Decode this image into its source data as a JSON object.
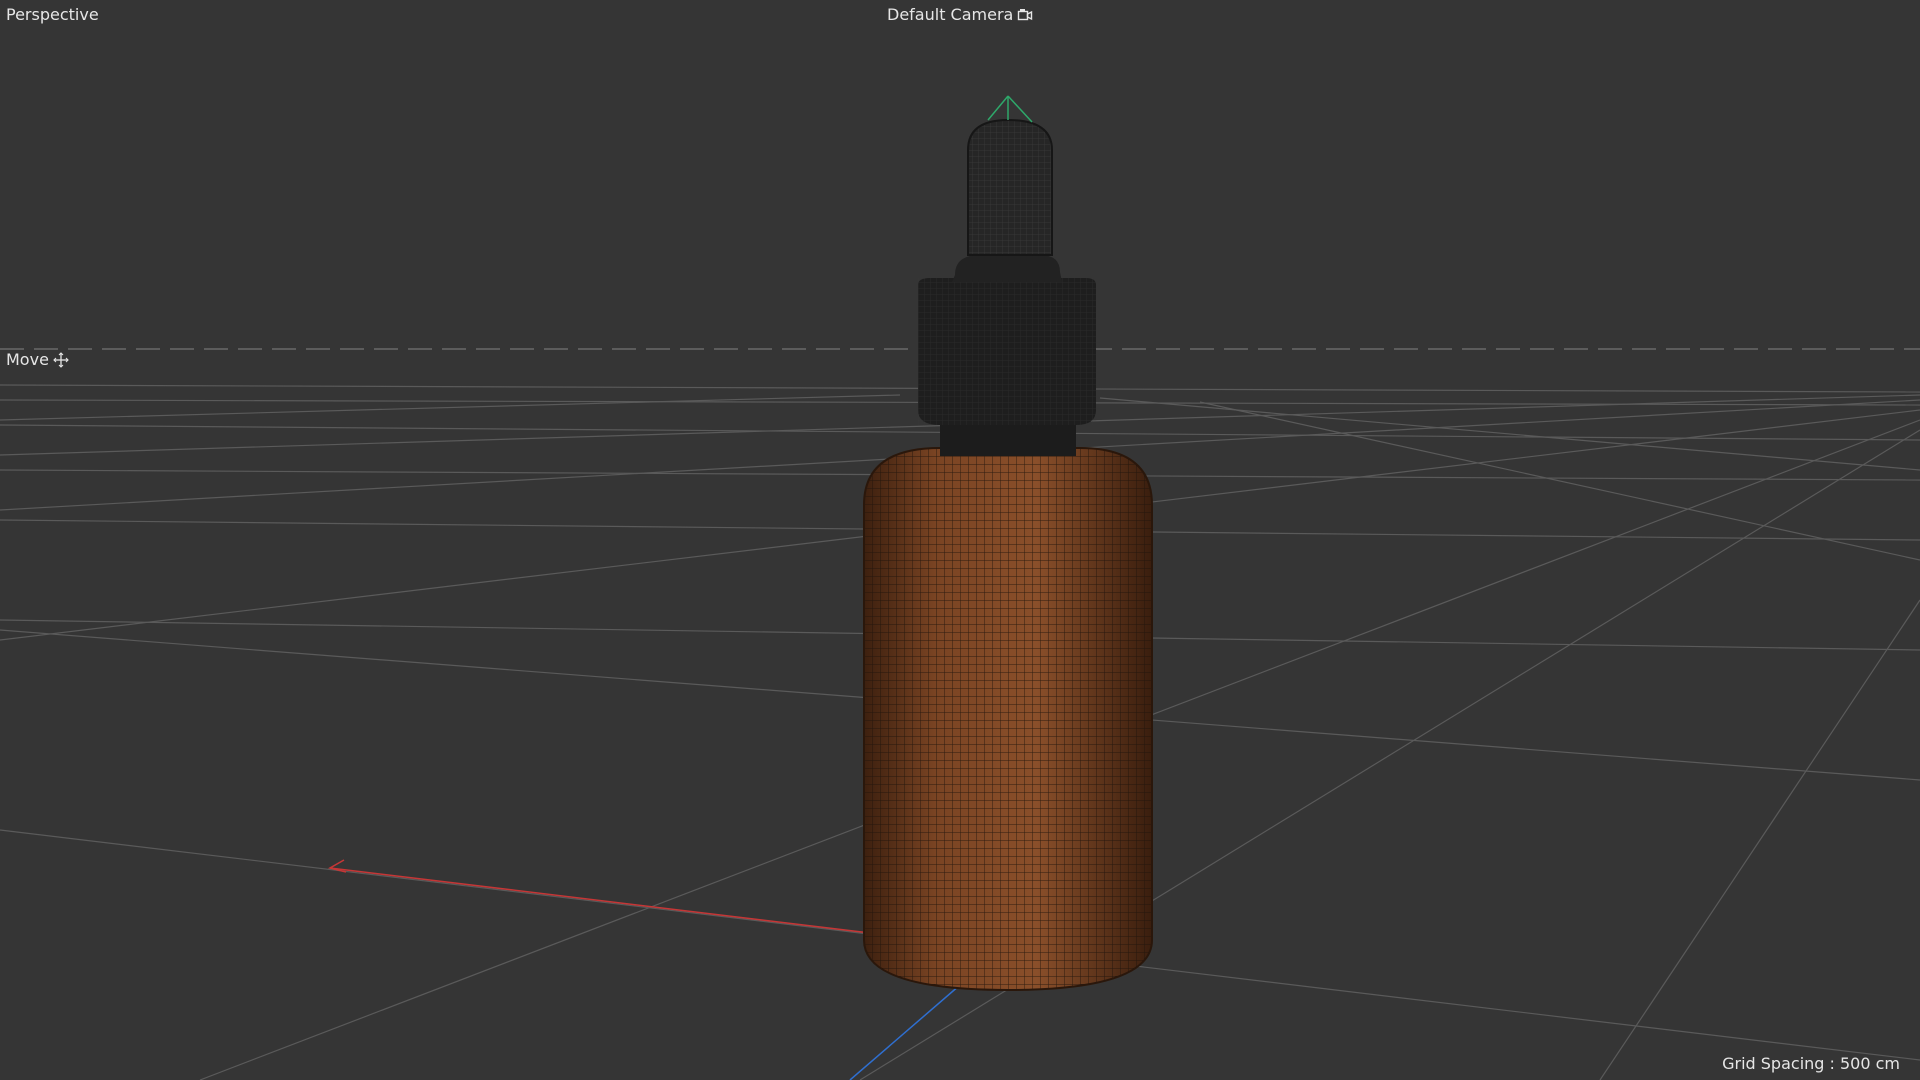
{
  "viewport": {
    "view_mode": "Perspective",
    "camera_label": "Default Camera",
    "tool_label": "Move",
    "grid_spacing_text": "Grid Spacing : 500 cm"
  },
  "icons": {
    "camera": "camera-icon",
    "move": "move-crosshair-icon"
  },
  "colors": {
    "background": "#353535",
    "grid_line": "#5a5a5a",
    "horizon_line": "#6e6e6e",
    "bottle_body": "#7a4423",
    "bottle_wire": "#2a1a10",
    "cap": "#1c1c1c",
    "axis_x": "#d23b3b",
    "axis_y": "#2ea86a",
    "axis_z": "#2f6fd0",
    "hud_text": "#e6e6e6"
  }
}
